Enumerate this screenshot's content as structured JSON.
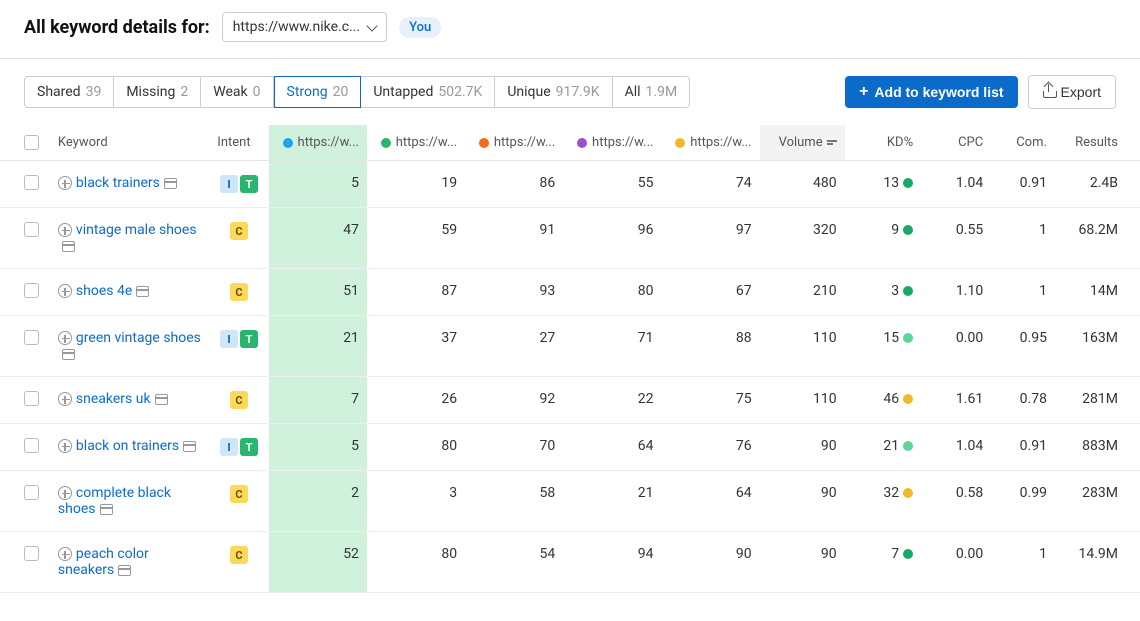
{
  "header": {
    "title": "All keyword details for:",
    "url_display": "https://www.nike.c...",
    "you_label": "You"
  },
  "filters": [
    {
      "label": "Shared",
      "count": "39",
      "active": false
    },
    {
      "label": "Missing",
      "count": "2",
      "active": false
    },
    {
      "label": "Weak",
      "count": "0",
      "active": false
    },
    {
      "label": "Strong",
      "count": "20",
      "active": true
    },
    {
      "label": "Untapped",
      "count": "502.7K",
      "active": false
    },
    {
      "label": "Unique",
      "count": "917.9K",
      "active": false
    },
    {
      "label": "All",
      "count": "1.9M",
      "active": false
    }
  ],
  "actions": {
    "add_to_list": "Add to keyword list",
    "export": "Export"
  },
  "columns": {
    "keyword": "Keyword",
    "intent": "Intent",
    "competitors": [
      {
        "label": "https://w...",
        "color": "#1fa3ec"
      },
      {
        "label": "https://w...",
        "color": "#2ab56f"
      },
      {
        "label": "https://w...",
        "color": "#f46b1f"
      },
      {
        "label": "https://w...",
        "color": "#9a4fd4"
      },
      {
        "label": "https://w...",
        "color": "#f2b92c"
      }
    ],
    "volume": "Volume",
    "kd": "KD%",
    "cpc": "CPC",
    "com": "Com.",
    "results": "Results"
  },
  "rows": [
    {
      "keyword": "black trainers",
      "intents": [
        "I",
        "T"
      ],
      "c": [
        "5",
        "19",
        "86",
        "55",
        "74"
      ],
      "volume": "480",
      "kd": "13",
      "kd_color": "#1aa86a",
      "cpc": "1.04",
      "com": "0.91",
      "results": "2.4B"
    },
    {
      "keyword": "vintage male shoes",
      "intents": [
        "C"
      ],
      "c": [
        "47",
        "59",
        "91",
        "96",
        "97"
      ],
      "volume": "320",
      "kd": "9",
      "kd_color": "#1aa86a",
      "cpc": "0.55",
      "com": "1",
      "results": "68.2M"
    },
    {
      "keyword": "shoes 4e",
      "intents": [
        "C"
      ],
      "c": [
        "51",
        "87",
        "93",
        "80",
        "67"
      ],
      "volume": "210",
      "kd": "3",
      "kd_color": "#1aa86a",
      "cpc": "1.10",
      "com": "1",
      "results": "14M"
    },
    {
      "keyword": "green vintage shoes",
      "intents": [
        "I",
        "T"
      ],
      "c": [
        "21",
        "37",
        "27",
        "71",
        "88"
      ],
      "volume": "110",
      "kd": "15",
      "kd_color": "#5dd39e",
      "cpc": "0.00",
      "com": "0.95",
      "results": "163M"
    },
    {
      "keyword": "sneakers uk",
      "intents": [
        "C"
      ],
      "c": [
        "7",
        "26",
        "92",
        "22",
        "75"
      ],
      "volume": "110",
      "kd": "46",
      "kd_color": "#f2b92c",
      "cpc": "1.61",
      "com": "0.78",
      "results": "281M"
    },
    {
      "keyword": "black on trainers",
      "intents": [
        "I",
        "T"
      ],
      "c": [
        "5",
        "80",
        "70",
        "64",
        "76"
      ],
      "volume": "90",
      "kd": "21",
      "kd_color": "#5dd39e",
      "cpc": "1.04",
      "com": "0.91",
      "results": "883M"
    },
    {
      "keyword": "complete black shoes",
      "intents": [
        "C"
      ],
      "c": [
        "2",
        "3",
        "58",
        "21",
        "64"
      ],
      "volume": "90",
      "kd": "32",
      "kd_color": "#f2b92c",
      "cpc": "0.58",
      "com": "0.99",
      "results": "283M"
    },
    {
      "keyword": "peach color sneakers",
      "intents": [
        "C"
      ],
      "c": [
        "52",
        "80",
        "54",
        "94",
        "90"
      ],
      "volume": "90",
      "kd": "7",
      "kd_color": "#1aa86a",
      "cpc": "0.00",
      "com": "1",
      "results": "14.9M"
    }
  ]
}
